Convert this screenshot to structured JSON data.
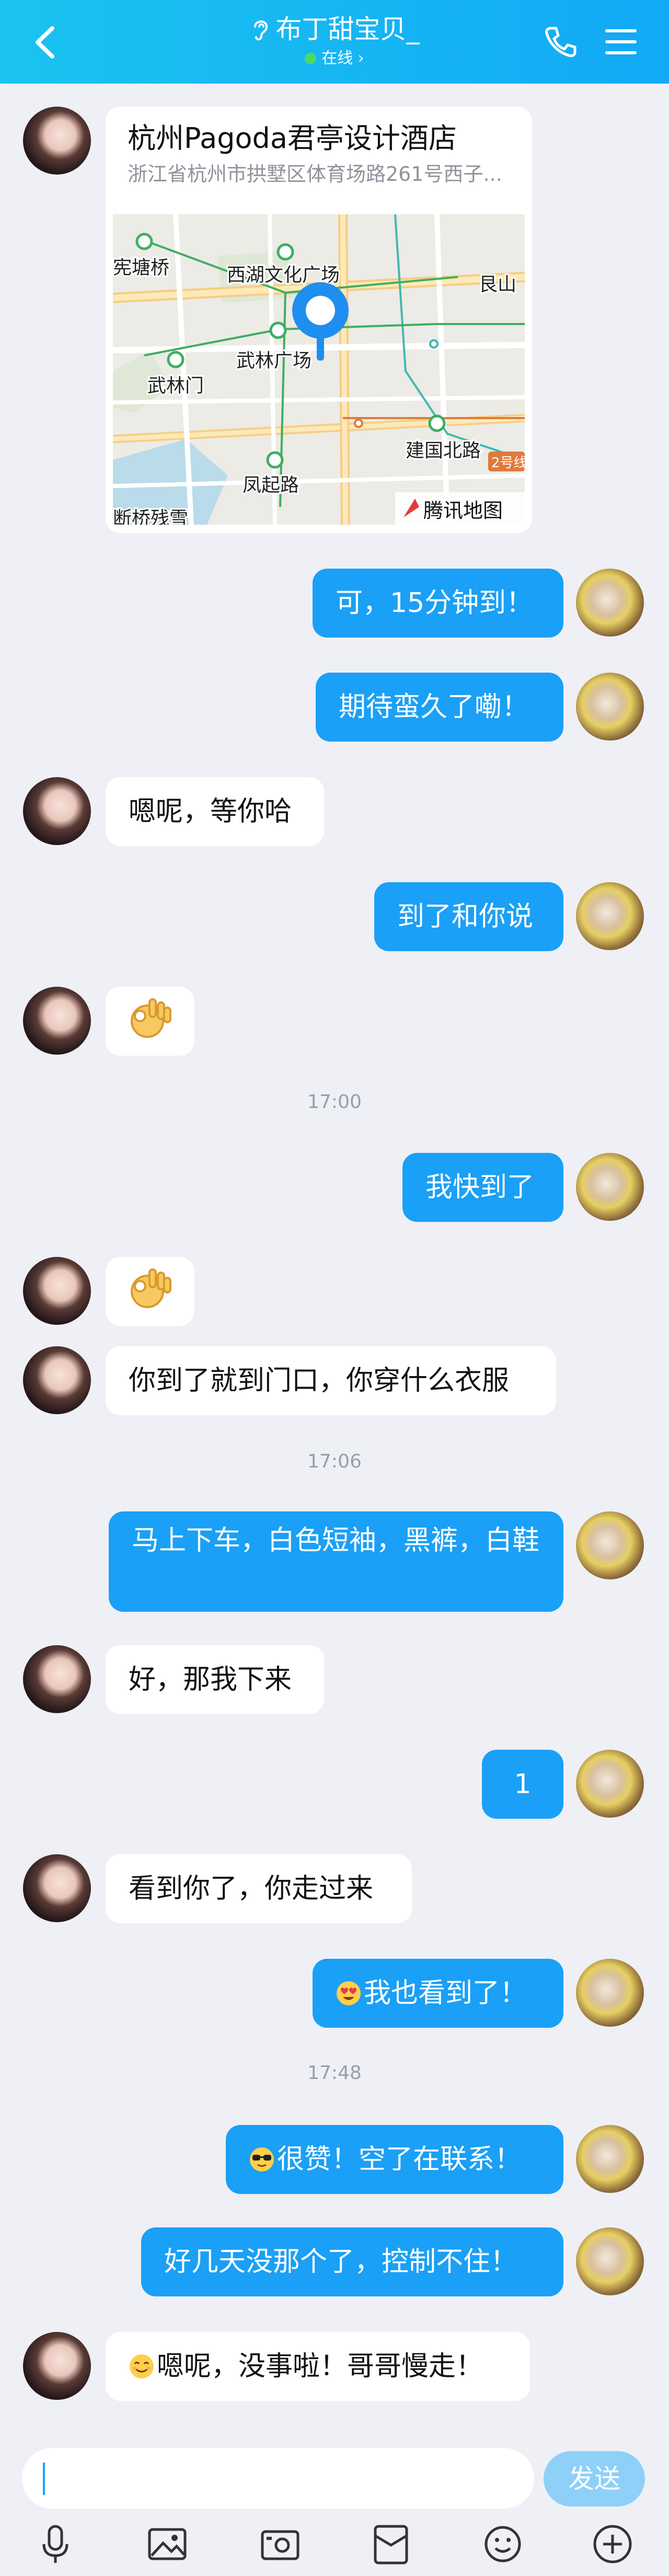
{
  "header": {
    "title": "布丁甜宝贝_",
    "status": "在线 ›",
    "colors": {
      "bar_start": "#1ac3f0",
      "bar_end": "#12a9f5",
      "online": "#4bd962"
    }
  },
  "location_card": {
    "name": "杭州Pagoda君亭设计酒店",
    "address": "浙江省杭州市拱墅区体育场路261号西子...",
    "map_labels": [
      "宪塘桥",
      "西湖文化广场",
      "艮山",
      "武林广场",
      "武林门",
      "建国北路",
      "凤起路",
      "断桥残雪",
      "2号线"
    ],
    "map_provider": "腾讯地图"
  },
  "timestamps": [
    "17:00",
    "17:06",
    "17:48"
  ],
  "messages": [
    {
      "side": "right",
      "text": "可，15分钟到！"
    },
    {
      "side": "right",
      "text": "期待蛮久了嘞！"
    },
    {
      "side": "left",
      "text": "嗯呢，等你哈"
    },
    {
      "side": "right",
      "text": "到了和你说"
    },
    {
      "side": "left",
      "emoji": "ok-hand-icon"
    },
    {
      "side": "right",
      "text": "我快到了"
    },
    {
      "side": "left",
      "emoji": "ok-hand-icon"
    },
    {
      "side": "left",
      "text": "你到了就到门口，你穿什么衣服"
    },
    {
      "side": "right",
      "text": "马上下车，白色短袖，黑裤，白鞋"
    },
    {
      "side": "left",
      "text": "好，那我下来"
    },
    {
      "side": "right",
      "text": "1"
    },
    {
      "side": "left",
      "text": "看到你了，你走过来"
    },
    {
      "side": "right",
      "emoji": "heart-eyes-icon",
      "text": "我也看到了！"
    },
    {
      "side": "right",
      "emoji": "sunglasses-icon",
      "text": "很赞！空了在联系！"
    },
    {
      "side": "right",
      "text": "好几天没那个了，控制不住！"
    },
    {
      "side": "left",
      "emoji": "smile-icon",
      "text": "嗯呢，没事啦！哥哥慢走！"
    }
  ],
  "input": {
    "value": "",
    "send_label": "发送"
  },
  "toolbar": [
    "microphone-icon",
    "image-icon",
    "camera-icon",
    "red-packet-icon",
    "emoji-icon",
    "plus-icon"
  ],
  "colors": {
    "bubble_out": "#1aa0f6",
    "bubble_in": "#ffffff",
    "background": "#eef0f5",
    "send_disabled": "#8fd0f8"
  }
}
